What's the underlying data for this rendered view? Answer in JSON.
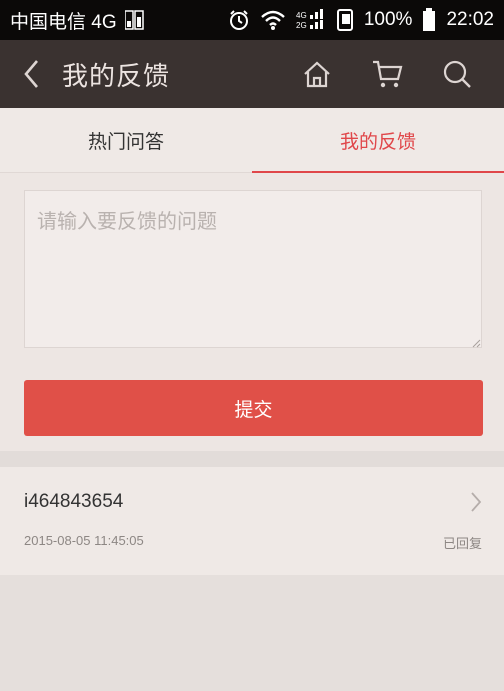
{
  "status_bar": {
    "carrier": "中国电信 4G",
    "network_2g_4g": "4G 2G",
    "battery": "100%",
    "time": "22:02"
  },
  "header": {
    "title": "我的反馈",
    "icons": [
      "back-icon",
      "home-icon",
      "cart-icon",
      "search-icon"
    ]
  },
  "tabs": [
    {
      "label": "热门问答",
      "active": false
    },
    {
      "label": "我的反馈",
      "active": true
    }
  ],
  "form": {
    "placeholder": "请输入要反馈的问题",
    "value": "",
    "submit_label": "提交"
  },
  "feedback_list": [
    {
      "user": "i464843654",
      "time": "2015-08-05 11:45:05",
      "status": "已回复"
    }
  ],
  "colors": {
    "accent": "#e0474a",
    "button": "#e05048",
    "header": "#3a3230",
    "status_bar": "#0b0908"
  }
}
